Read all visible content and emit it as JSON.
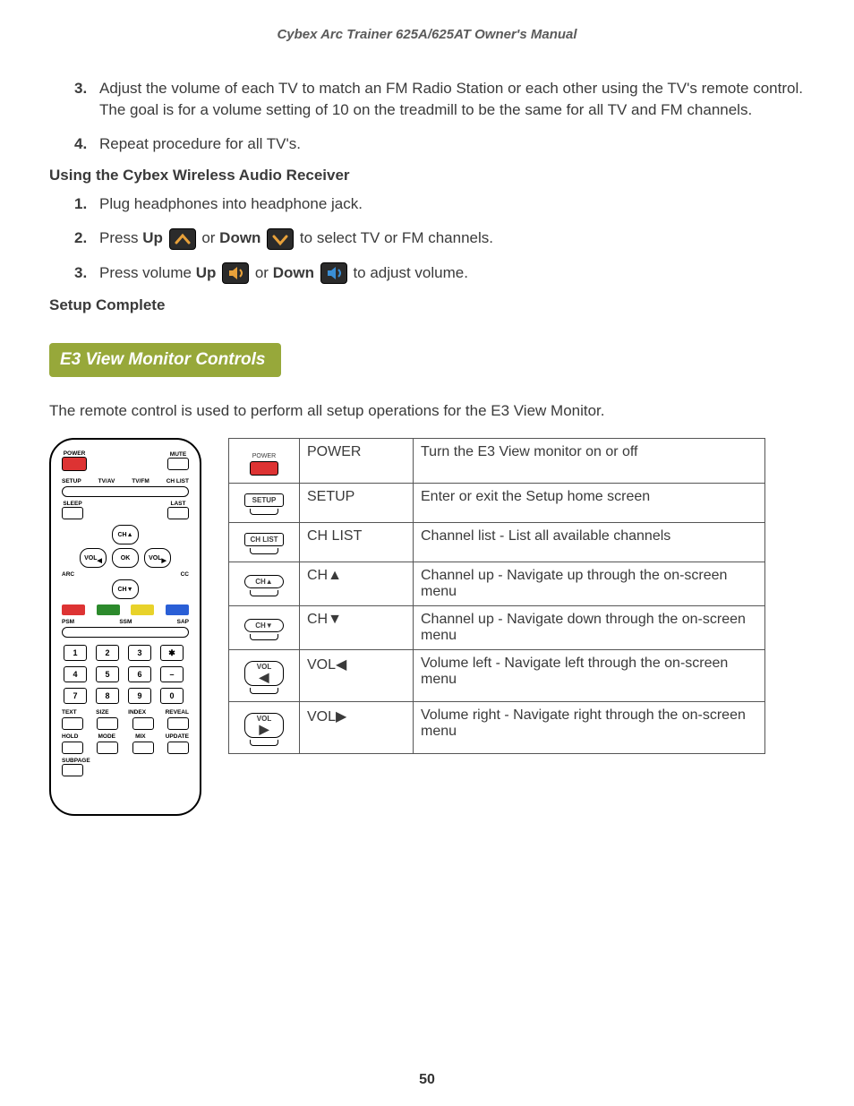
{
  "header": "Cybex Arc Trainer 625A/625AT Owner's Manual",
  "page_number": "50",
  "list_a": [
    {
      "n": "3.",
      "t": "Adjust the volume of each TV to match an FM Radio Station or each other using the TV's remote control. The goal is for a volume setting of 10 on the treadmill to be the same for all TV and FM channels."
    },
    {
      "n": "4.",
      "t": "Repeat procedure for all TV's."
    }
  ],
  "sub1": "Using the Cybex Wireless Audio Receiver",
  "list_b": [
    {
      "n": "1.",
      "t": "Plug headphones into headphone jack."
    },
    {
      "n": "2.",
      "pre": "Press ",
      "b1": "Up",
      "mid": " or ",
      "b2": "Down",
      "post": " to select TV or FM channels."
    },
    {
      "n": "3.",
      "pre": "Press volume ",
      "b1": "Up",
      "mid": " or ",
      "b2": "Down",
      "post": " to adjust volume."
    }
  ],
  "sub2": "Setup Complete",
  "section_title": "E3 View Monitor Controls",
  "intro": "The remote control is used to perform all setup operations for the E3 View Monitor.",
  "remote": {
    "power": "POWER",
    "mute": "MUTE",
    "row2": [
      "SETUP",
      "TV/AV",
      "TV/FM",
      "CH LIST"
    ],
    "sleep": "SLEEP",
    "last": "LAST",
    "ch_up": "CH▲",
    "ch_dn": "CH▼",
    "vol_l": "VOL",
    "vol_r": "VOL",
    "ok": "OK",
    "arc": "ARC",
    "cc": "CC",
    "psm": "PSM",
    "ssm": "SSM",
    "sap": "SAP",
    "nums": [
      "1",
      "2",
      "3",
      "✱",
      "4",
      "5",
      "6",
      "–",
      "7",
      "8",
      "9",
      "0"
    ],
    "bottom1": [
      "TEXT",
      "SIZE",
      "INDEX",
      "REVEAL"
    ],
    "bottom2": [
      "HOLD",
      "MODE",
      "MIX",
      "UPDATE"
    ],
    "subpage": "SUBPAGE"
  },
  "table": [
    {
      "icon": "power",
      "name": "POWER",
      "desc": "Turn the E3 View monitor on or off"
    },
    {
      "icon": "setup",
      "name": "SETUP",
      "desc": "Enter or exit the Setup home screen"
    },
    {
      "icon": "chlist",
      "name": "CH LIST",
      "desc": "Channel list - List all available channels"
    },
    {
      "icon": "chup",
      "name": "CH▲",
      "desc": "Channel up - Navigate up through the on-screen menu"
    },
    {
      "icon": "chdn",
      "name": "CH▼",
      "desc": "Channel up - Navigate down through the on-screen menu"
    },
    {
      "icon": "voll",
      "name": "VOL◀",
      "desc": "Volume left - Navigate left through the on-screen menu"
    },
    {
      "icon": "volr",
      "name": "VOL▶",
      "desc": "Volume right - Navigate right through the on-screen menu"
    }
  ],
  "icon_labels": {
    "power": "POWER",
    "setup": "SETUP",
    "chlist": "CH LIST",
    "chup": "CH▲",
    "chdn": "CH▼",
    "voll_txt": "VOL",
    "volr_txt": "VOL"
  }
}
